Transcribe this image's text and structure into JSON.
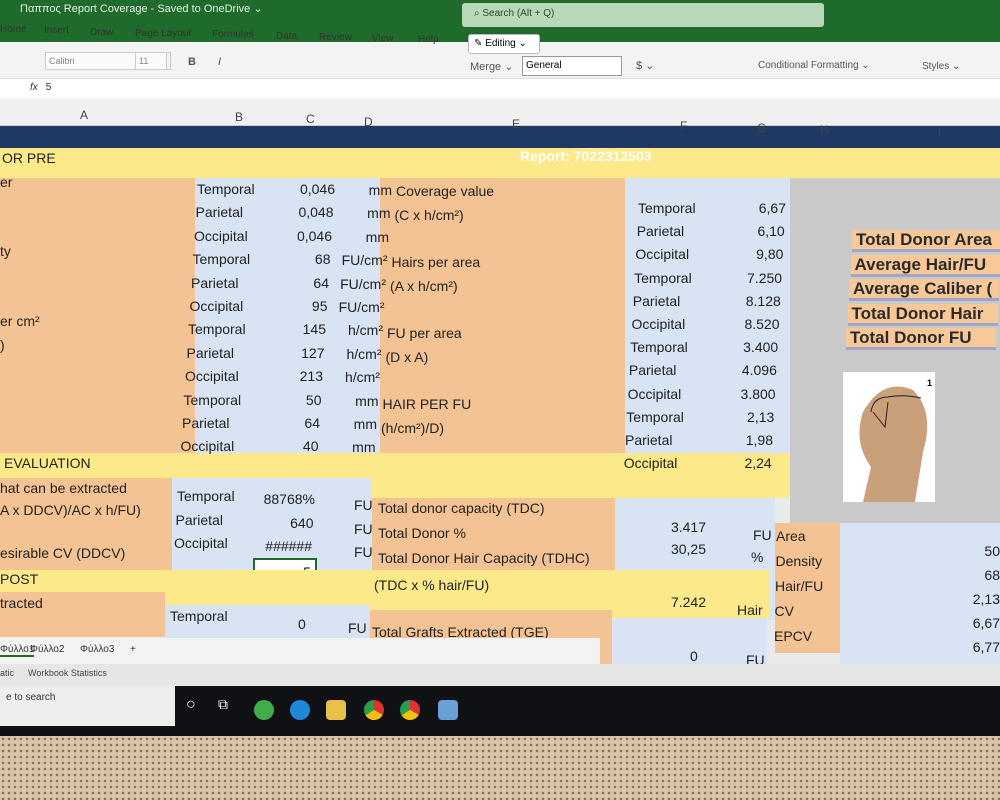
{
  "window": {
    "title": "Παππος Report Coverage - Saved to OneDrive ⌄",
    "search_placeholder": "⌕ Search (Alt + Q)"
  },
  "ribbon": {
    "tabs": [
      "Home",
      "Insert",
      "Draw",
      "Page Layout",
      "Formulas",
      "Data",
      "Review",
      "View",
      "Help"
    ],
    "editing": "✎ Editing ⌄",
    "font": "Calibri",
    "size": "11",
    "bold": "B",
    "italic": "I",
    "merge": "Merge ⌄",
    "number_format": "General",
    "currency": "$ ⌄",
    "conditional": "Conditional Formatting ⌄",
    "styles": "Styles ⌄"
  },
  "formula_bar": {
    "fx": "fx",
    "value": "5"
  },
  "columns": [
    "A",
    "B",
    "C",
    "D",
    "E",
    "F",
    "G",
    "H",
    "I"
  ],
  "report": "Report: 7022312503",
  "sections": {
    "pre": "OR PRE",
    "evaluation": "EVALUATION",
    "post": "POST"
  },
  "col_a": [
    "er",
    "ty",
    "er cm²",
    ")"
  ],
  "pre_rows": [
    {
      "zone": "Temporal",
      "value": "0,046",
      "unit": "mm",
      "desc": "Coverage value",
      "zone2": "Temporal",
      "value2": "6,67"
    },
    {
      "zone": "Parietal",
      "value": "0,048",
      "unit": "mm",
      "desc": "(C x h/cm²)",
      "zone2": "Parietal",
      "value2": "6,10"
    },
    {
      "zone": "Occipital",
      "value": "0,046",
      "unit": "mm",
      "desc": "",
      "zone2": "Occipital",
      "value2": "9,80"
    },
    {
      "zone": "Temporal",
      "value": "68",
      "unit": "FU/cm²",
      "desc": "Hairs per area",
      "zone2": "Temporal",
      "value2": "7.250"
    },
    {
      "zone": "Parietal",
      "value": "64",
      "unit": "FU/cm²",
      "desc": "(A x h/cm²)",
      "zone2": "Parietal",
      "value2": "8.128"
    },
    {
      "zone": "Occipital",
      "value": "95",
      "unit": "FU/cm²",
      "desc": "",
      "zone2": "Occipital",
      "value2": "8.520"
    },
    {
      "zone": "Temporal",
      "value": "145",
      "unit": "h/cm²",
      "desc": "FU per area",
      "zone2": "Temporal",
      "value2": "3.400"
    },
    {
      "zone": "Parietal",
      "value": "127",
      "unit": "h/cm²",
      "desc": "(D x A)",
      "zone2": "Parietal",
      "value2": "4.096"
    },
    {
      "zone": "Occipital",
      "value": "213",
      "unit": "h/cm²",
      "desc": "",
      "zone2": "Occipital",
      "value2": "3.800"
    },
    {
      "zone": "Temporal",
      "value": "50",
      "unit": "mm",
      "desc": "HAIR PER FU",
      "zone2": "Temporal",
      "value2": "2,13"
    },
    {
      "zone": "Parietal",
      "value": "64",
      "unit": "mm",
      "desc": "(h/cm²)/D)",
      "zone2": "Parietal",
      "value2": "1,98"
    },
    {
      "zone": "Occipital",
      "value": "40",
      "unit": "mm",
      "desc": "",
      "zone2": "Occipital",
      "value2": "2,24"
    }
  ],
  "summary_labels": [
    "Total Donor Area",
    "Average Hair/FU",
    "Average Caliber (",
    "Total Donor Hair",
    "Total Donor FU"
  ],
  "image_number": "1",
  "evaluation": {
    "col_a": [
      "hat can be extracted",
      "A x DDCV)/AC x h/FU)",
      "esirable CV (DDCV)"
    ],
    "rows": [
      {
        "zone": "Temporal",
        "value": "88768%",
        "unit": "FU",
        "desc": "Total donor capacity (TDC)"
      },
      {
        "zone": "Parietal",
        "value": "640",
        "unit": "FU",
        "desc": "Total Donor %"
      },
      {
        "zone": "Occipital",
        "value": "######",
        "unit": "FU",
        "desc": "Total Donor Hair Capacity (TDHC)"
      }
    ],
    "desc_extra": "(TDC x % hair/FU)",
    "selected_value": "5",
    "results": [
      {
        "value": "3.417",
        "unit": "FU"
      },
      {
        "value": "30,25",
        "unit": "%"
      },
      {
        "value": "7.242",
        "unit": "Hair"
      }
    ],
    "right_labels": [
      "Area",
      "Density",
      "Hair/FU",
      "CV",
      "EPCV"
    ],
    "right_values": [
      "50",
      "68",
      "2,13",
      "6,67",
      "6,77"
    ]
  },
  "post": {
    "col_a": "tracted",
    "zone": "Temporal",
    "value": "0",
    "unit": "FU",
    "desc": "Total Grafts Extracted (TGE)",
    "result": "0",
    "result_unit": "FU"
  },
  "sheets": [
    "Φύλλο1",
    "Φύλλο2",
    "Φύλλο3",
    "+"
  ],
  "status": {
    "left": "atic",
    "stats": "Workbook Statistics"
  },
  "taskbar": {
    "search": "e to search"
  }
}
